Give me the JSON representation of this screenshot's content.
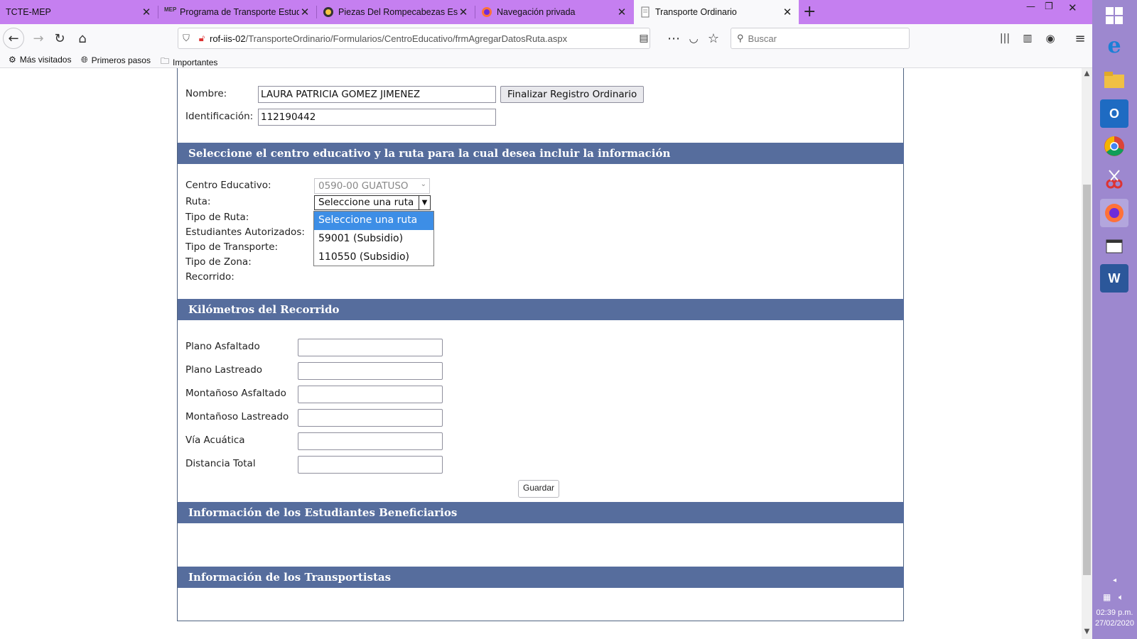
{
  "browser": {
    "tabs": [
      {
        "title": "TCTE-MEP",
        "active": false
      },
      {
        "title": "Programa de Transporte Estudi",
        "active": false
      },
      {
        "title": "Piezas Del Rompecabezas Está",
        "active": false
      },
      {
        "title": "Navegación privada",
        "active": false
      },
      {
        "title": "Transporte Ordinario",
        "active": true
      }
    ],
    "url_host": "rof-iis-02",
    "url_path": "/TransporteOrdinario/Formularios/CentroEducativo/frmAgregarDatosRuta.aspx",
    "search_placeholder": "Buscar",
    "bookmarks": [
      "Más visitados",
      "Primeros pasos",
      "Importantes"
    ]
  },
  "form": {
    "nombre_label": "Nombre:",
    "nombre_value": "LAURA PATRICIA GOMEZ JIMENEZ",
    "identificacion_label": "Identificación:",
    "identificacion_value": "112190442",
    "finalizar_button": "Finalizar Registro Ordinario"
  },
  "sections": {
    "seleccion": "Seleccione el centro educativo y la ruta para la cual desea incluir la información",
    "kilometros": "Kilómetros del Recorrido",
    "estudiantes": "Información de los Estudiantes Beneficiarios",
    "transportistas": "Información de los Transportistas"
  },
  "route": {
    "centro_label": "Centro Educativo:",
    "centro_value": "0590-00 GUATUSO",
    "ruta_label": "Ruta:",
    "ruta_selected": "Seleccione una ruta",
    "tipo_ruta_label": "Tipo de Ruta:",
    "estudiantes_label": "Estudiantes Autorizados:",
    "tipo_transporte_label": "Tipo de Transporte:",
    "tipo_zona_label": "Tipo de Zona:",
    "recorrido_label": "Recorrido:",
    "options": [
      "Seleccione una ruta",
      "59001 (Subsidio)",
      "110550 (Subsidio)"
    ]
  },
  "km": {
    "fields": [
      "Plano Asfaltado",
      "Plano Lastreado",
      "Montañoso Asfaltado",
      "Montañoso Lastreado",
      "Vía Acuática",
      "Distancia Total"
    ],
    "guardar": "Guardar"
  },
  "taskbar": {
    "time": "02:39 p.m.",
    "date": "27/02/2020"
  },
  "colors": {
    "tabstrip": "#c57ff0",
    "section_header": "#566d9d",
    "dropdown_highlight": "#3d8ee6",
    "taskbar": "#9d88cf"
  }
}
